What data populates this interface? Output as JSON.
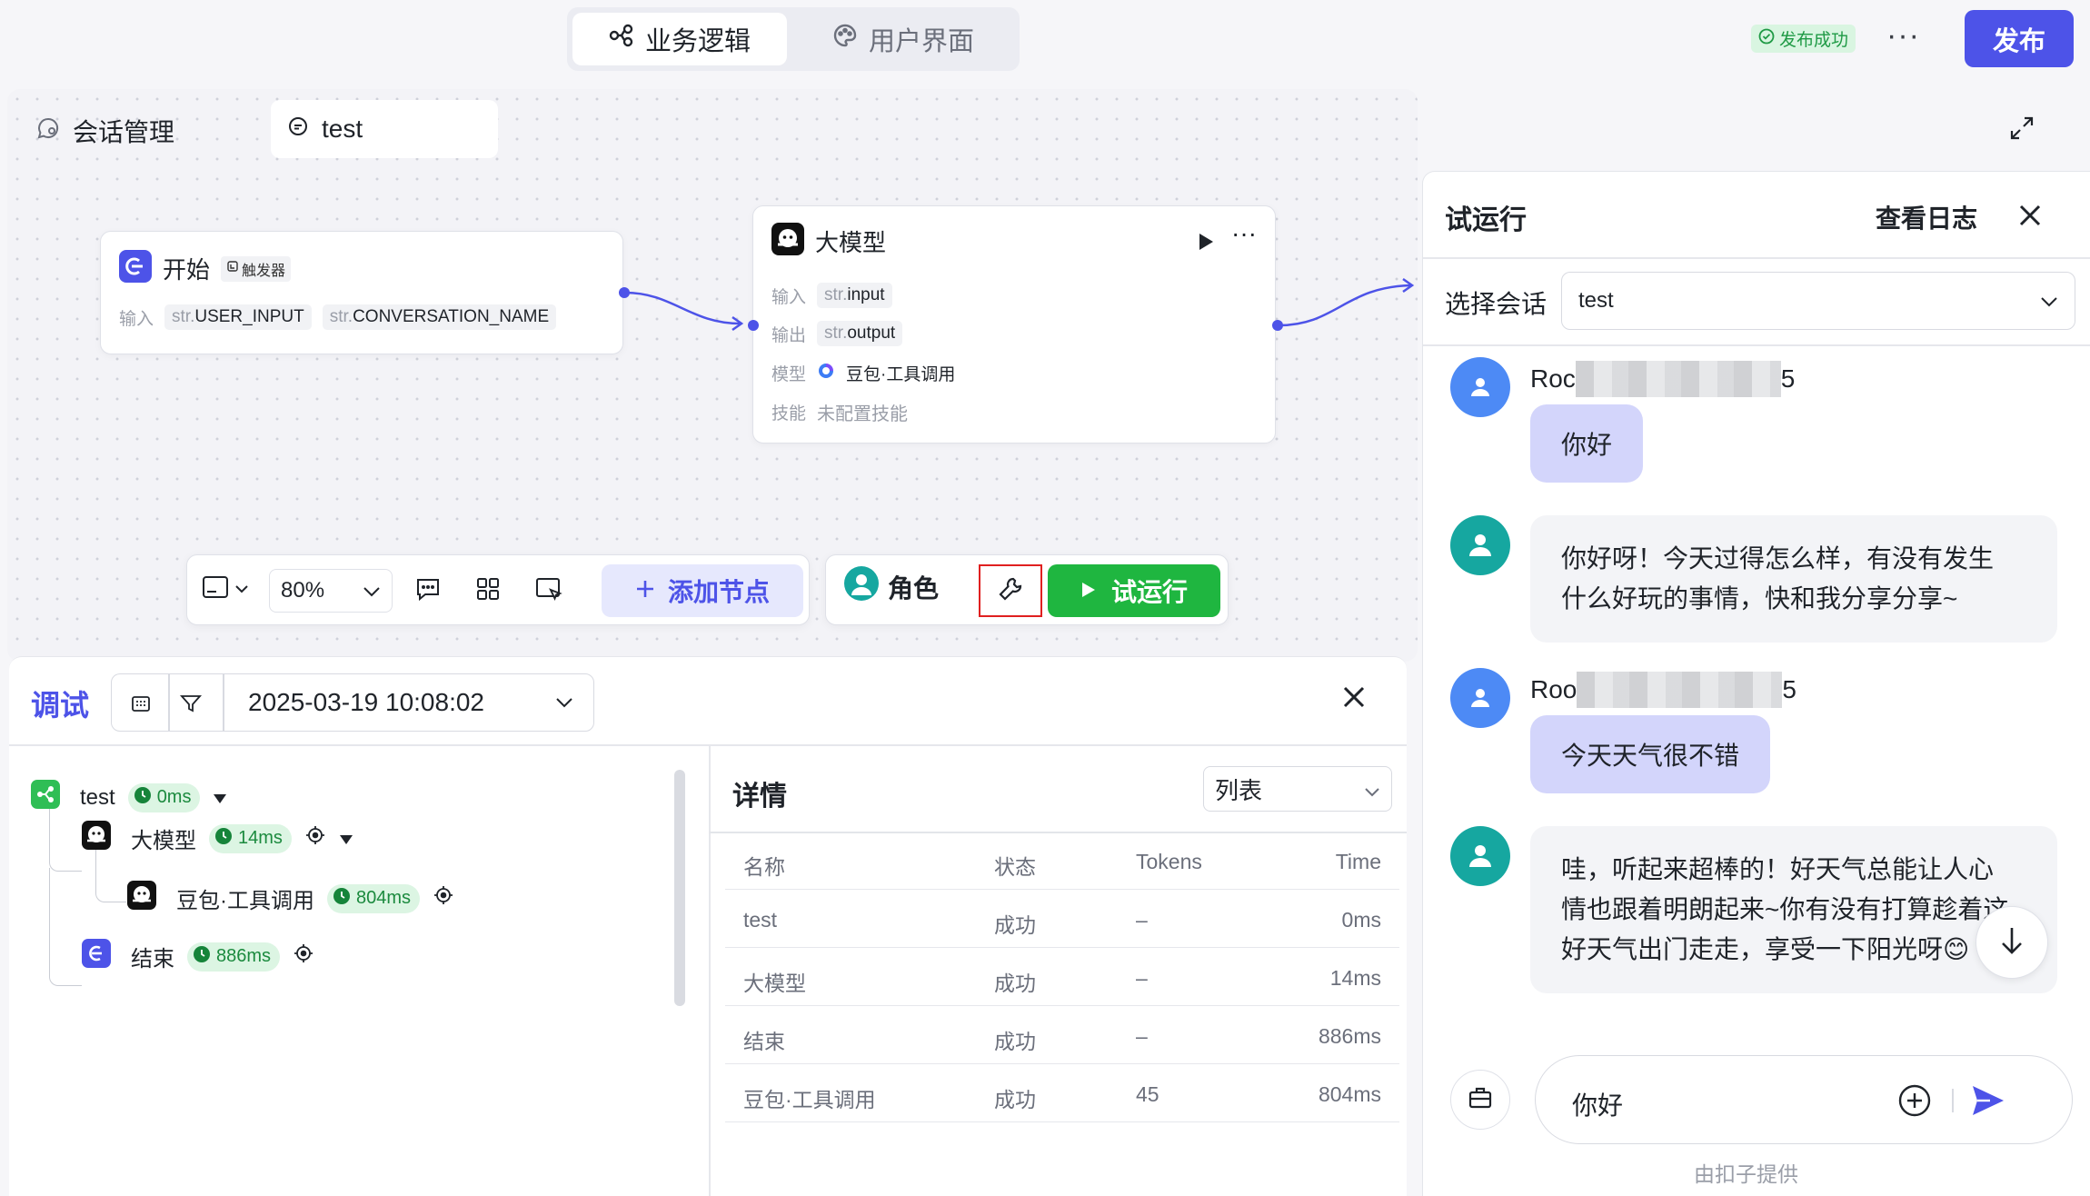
{
  "header": {
    "tabs": [
      {
        "label": "业务逻辑",
        "icon": "workflow-icon",
        "active": true
      },
      {
        "label": "用户界面",
        "icon": "palette-icon",
        "active": false
      }
    ],
    "status_badge": "发布成功",
    "more_label": "···",
    "publish_label": "发布"
  },
  "canvas": {
    "conversation_manage_label": "会话管理",
    "conversation_tab": "test",
    "start_node": {
      "title": "开始",
      "trigger_tag": "触发器",
      "input_label": "输入",
      "vars": [
        {
          "type": "str.",
          "name": "USER_INPUT"
        },
        {
          "type": "str.",
          "name": "CONVERSATION_NAME"
        }
      ]
    },
    "llm_node": {
      "title": "大模型",
      "rows": [
        {
          "label": "输入",
          "type": "str.",
          "value": "input"
        },
        {
          "label": "输出",
          "type": "str.",
          "value": "output"
        }
      ],
      "model_label": "模型",
      "model_value": "豆包·工具调用",
      "skill_label": "技能",
      "skill_value": "未配置技能"
    },
    "toolbar": {
      "zoom": "80%",
      "add_node_label": "添加节点",
      "role_label": "角色",
      "run_label": "试运行"
    }
  },
  "debug": {
    "title": "调试",
    "date": "2025-03-19 10:08:02",
    "tree": [
      {
        "name": "test",
        "time": "0ms"
      },
      {
        "name": "大模型",
        "time": "14ms"
      },
      {
        "name": "豆包·工具调用",
        "time": "804ms"
      },
      {
        "name": "结束",
        "time": "886ms"
      }
    ],
    "detail_title": "详情",
    "view_mode": "列表",
    "table": {
      "headers": [
        "名称",
        "状态",
        "Tokens",
        "Time"
      ],
      "rows": [
        [
          "test",
          "成功",
          "–",
          "0ms"
        ],
        [
          "大模型",
          "成功",
          "–",
          "14ms"
        ],
        [
          "结束",
          "成功",
          "–",
          "886ms"
        ],
        [
          "豆包·工具调用",
          "成功",
          "45",
          "804ms"
        ]
      ]
    }
  },
  "chat": {
    "title": "试运行",
    "view_log": "查看日志",
    "session_label": "选择会话",
    "session_value": "test",
    "messages": [
      {
        "role": "user",
        "name_prefix": "Roc",
        "name_suffix": "5",
        "text": "你好"
      },
      {
        "role": "bot",
        "lines": [
          "你好呀！今天过得怎么样，有没有发生",
          "什么好玩的事情，快和我分享分享~"
        ]
      },
      {
        "role": "user",
        "name_prefix": "Roo",
        "name_suffix": "5",
        "text": "今天天气很不错"
      },
      {
        "role": "bot",
        "lines": [
          "哇，听起来超棒的！好天气总能让人心",
          "情也跟着明朗起来~你有没有打算趁着这",
          "好天气出门走走，享受一下阳光呀😊"
        ]
      }
    ],
    "input_value": "你好",
    "footer": "由扣子提供"
  }
}
